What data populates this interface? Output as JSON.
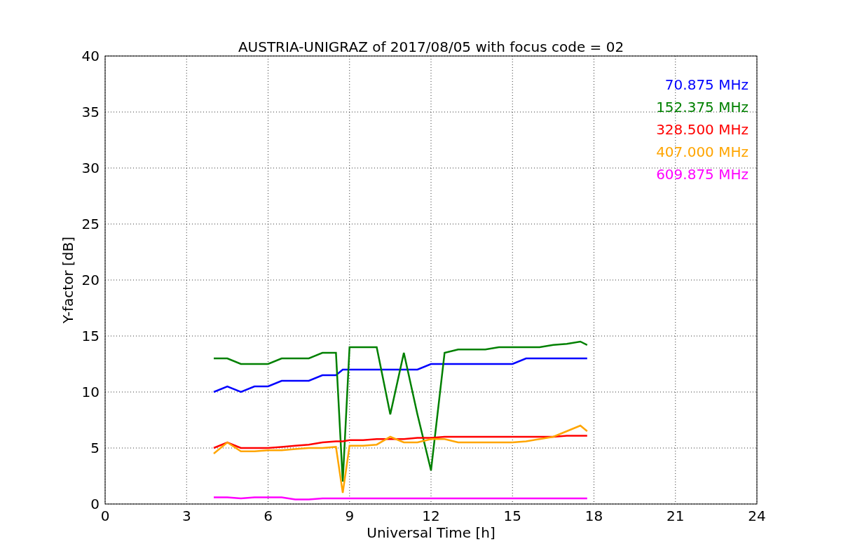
{
  "figure": {
    "chart_data": {
      "type": "line",
      "title": "AUSTRIA-UNIGRAZ of 2017/08/05 with focus code = 02",
      "xlabel": "Universal Time [h]",
      "ylabel": "Y-factor [dB]",
      "x": [
        4,
        4.5,
        5,
        5.5,
        6,
        6.5,
        7,
        7.5,
        8,
        8.5,
        8.75,
        9,
        9.5,
        10,
        10.5,
        11,
        11.5,
        12,
        12.5,
        13,
        13.5,
        14,
        14.5,
        15,
        15.5,
        16,
        16.5,
        17,
        17.5,
        17.75
      ],
      "series": [
        {
          "name": "70.875 MHz",
          "color": "#0000ff",
          "values": [
            10,
            10.5,
            10,
            10.5,
            10.5,
            11,
            11,
            11,
            11.5,
            11.5,
            12,
            12,
            12,
            12,
            12,
            12,
            12,
            12.5,
            12.5,
            12.5,
            12.5,
            12.5,
            12.5,
            12.5,
            13,
            13,
            13,
            13,
            13,
            13
          ]
        },
        {
          "name": "152.375 MHz",
          "color": "#008000",
          "values": [
            13,
            13,
            12.5,
            12.5,
            12.5,
            13,
            13,
            13,
            13.5,
            13.5,
            2,
            14,
            14,
            14,
            8,
            13.5,
            8,
            3,
            13.5,
            13.8,
            13.8,
            13.8,
            14,
            14,
            14,
            14,
            14.2,
            14.3,
            14.5,
            14.2
          ]
        },
        {
          "name": "328.500 MHz",
          "color": "#ff0000",
          "values": [
            5,
            5.5,
            5,
            5,
            5,
            5.1,
            5.2,
            5.3,
            5.5,
            5.6,
            5.6,
            5.7,
            5.7,
            5.8,
            5.8,
            5.8,
            5.9,
            5.9,
            6,
            6,
            6,
            6,
            6,
            6,
            6,
            6,
            6,
            6.1,
            6.1,
            6.1
          ]
        },
        {
          "name": "407.000 MHz",
          "color": "#ffa500",
          "values": [
            4.5,
            5.5,
            4.7,
            4.7,
            4.8,
            4.8,
            4.9,
            5,
            5,
            5.1,
            1,
            5.2,
            5.2,
            5.3,
            6,
            5.5,
            5.5,
            5.8,
            5.8,
            5.5,
            5.5,
            5.5,
            5.5,
            5.5,
            5.6,
            5.8,
            6,
            6.5,
            7,
            6.5
          ]
        },
        {
          "name": "609.875 MHz",
          "color": "#ff00ff",
          "values": [
            0.6,
            0.6,
            0.5,
            0.6,
            0.6,
            0.6,
            0.4,
            0.4,
            0.5,
            0.5,
            0.5,
            0.5,
            0.5,
            0.5,
            0.5,
            0.5,
            0.5,
            0.5,
            0.5,
            0.5,
            0.5,
            0.5,
            0.5,
            0.5,
            0.5,
            0.5,
            0.5,
            0.5,
            0.5,
            0.5
          ]
        }
      ],
      "grid": true,
      "xlim": [
        0,
        24
      ],
      "ylim": [
        0,
        40
      ],
      "xticks": [
        0,
        3,
        6,
        9,
        12,
        15,
        18,
        21,
        24
      ],
      "yticks": [
        0,
        5,
        10,
        15,
        20,
        25,
        30,
        35,
        40
      ]
    }
  }
}
